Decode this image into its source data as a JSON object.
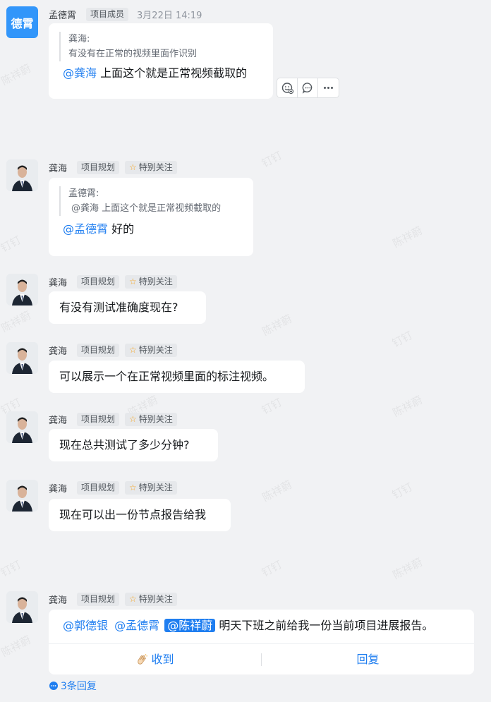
{
  "messages": [
    {
      "sender": "孟德霄",
      "avatar_text": "德霄",
      "tags": [
        "项目成员"
      ],
      "time": "3月22日 14:19",
      "quote_author": "龚海:",
      "quote_text": "有没有在正常的视频里面作识别",
      "mention": "@龚海",
      "text": " 上面这个就是正常视频截取的"
    },
    {
      "sender": "龚海",
      "tags": [
        "项目规划"
      ],
      "special": "特别关注",
      "quote_author": "孟德霄:",
      "quote_text": "@龚海 上面这个就是正常视频截取的",
      "mention": "@孟德霄",
      "text": " 好的"
    },
    {
      "sender": "龚海",
      "tags": [
        "项目规划"
      ],
      "special": "特别关注",
      "text": "有没有测试准确度现在?"
    },
    {
      "sender": "龚海",
      "tags": [
        "项目规划"
      ],
      "special": "特别关注",
      "text": "可以展示一个在正常视频里面的标注视频。"
    },
    {
      "sender": "龚海",
      "tags": [
        "项目规划"
      ],
      "special": "特别关注",
      "text": "现在总共测试了多少分钟?"
    },
    {
      "sender": "龚海",
      "tags": [
        "项目规划"
      ],
      "special": "特别关注",
      "text": "现在可以出一份节点报告给我"
    },
    {
      "sender": "龚海",
      "tags": [
        "项目规划"
      ],
      "special": "特别关注",
      "mentions": [
        "@郭德银",
        "@孟德霄",
        "@陈祥蔚"
      ],
      "text": " 明天下班之前给我一份当前项目进展报告。",
      "received_label": "收到",
      "reply_label": "回复",
      "thread_replies": "3条回复"
    }
  ],
  "watermarks": [
    "钉钉",
    "陈祥蔚"
  ],
  "colors": {
    "accent": "#1f7ef0",
    "avatar_bg": "#3296fa",
    "background": "#f1f2f4",
    "star": "#f5a623"
  },
  "icons": [
    "emoji-reaction-icon",
    "comment-icon",
    "more-icon",
    "clap-icon",
    "thread-icon",
    "star-icon"
  ]
}
